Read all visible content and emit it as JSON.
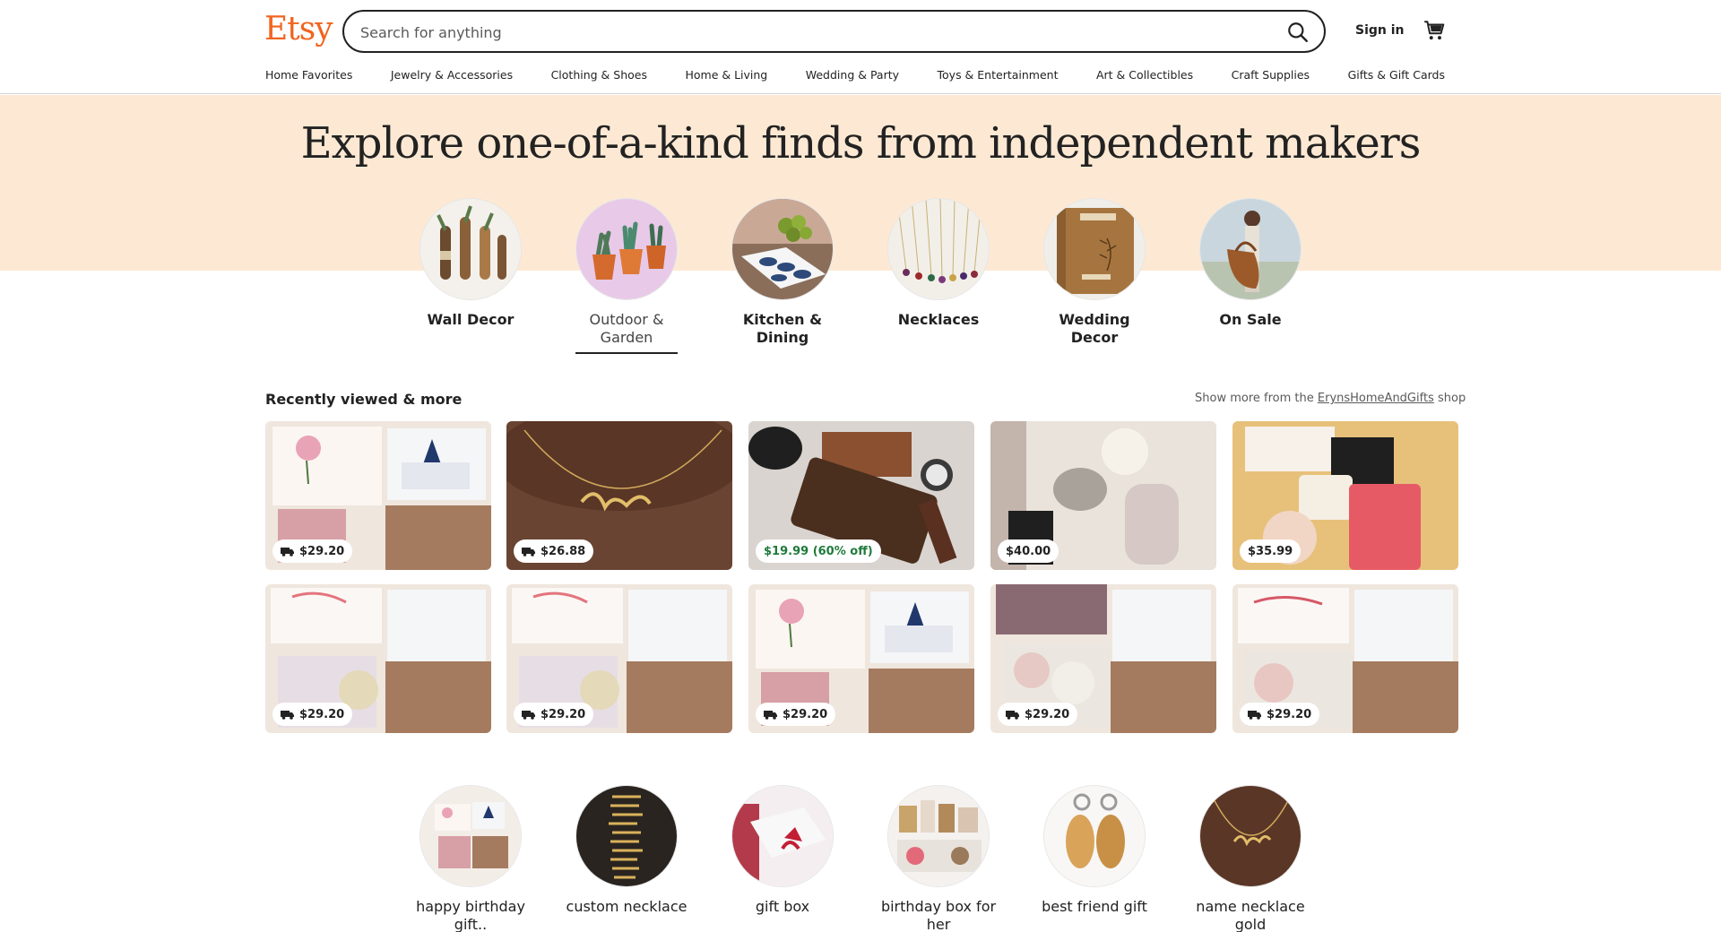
{
  "header": {
    "logo": "Etsy",
    "search_placeholder": "Search for anything",
    "signin": "Sign in",
    "nav": [
      "Home Favorites",
      "Jewelry & Accessories",
      "Clothing & Shoes",
      "Home & Living",
      "Wedding & Party",
      "Toys & Entertainment",
      "Art & Collectibles",
      "Craft Supplies",
      "Gifts & Gift Cards"
    ]
  },
  "hero": {
    "title": "Explore one-of-a-kind finds from independent makers",
    "categories": [
      {
        "label": "Wall Decor",
        "active": false
      },
      {
        "label": "Outdoor & Garden",
        "active": true
      },
      {
        "label": "Kitchen & Dining",
        "active": false
      },
      {
        "label": "Necklaces",
        "active": false
      },
      {
        "label": "Wedding Decor",
        "active": false
      },
      {
        "label": "On Sale",
        "active": false
      }
    ]
  },
  "recently_viewed": {
    "title": "Recently viewed & more",
    "more_prefix": "Show more from the",
    "shop_name": "ErynsHomeAndGifts",
    "more_suffix": "shop",
    "items": [
      {
        "price": "$29.20",
        "free_shipping": true,
        "sale": false
      },
      {
        "price": "$26.88",
        "free_shipping": true,
        "sale": false
      },
      {
        "price": "$19.99 (60% off)",
        "free_shipping": false,
        "sale": true
      },
      {
        "price": "$40.00",
        "free_shipping": false,
        "sale": false
      },
      {
        "price": "$35.99",
        "free_shipping": false,
        "sale": false
      },
      {
        "price": "$29.20",
        "free_shipping": true,
        "sale": false
      },
      {
        "price": "$29.20",
        "free_shipping": true,
        "sale": false
      },
      {
        "price": "$29.20",
        "free_shipping": true,
        "sale": false
      },
      {
        "price": "$29.20",
        "free_shipping": true,
        "sale": false
      },
      {
        "price": "$29.20",
        "free_shipping": true,
        "sale": false
      }
    ]
  },
  "searches": [
    "happy birthday gift..",
    "custom necklace",
    "gift box",
    "birthday box for her",
    "best friend gift",
    "name necklace gold"
  ],
  "colors": {
    "brand": "#f1641e",
    "hero_bg": "#fde9d3",
    "sale_green": "#1f7a3a"
  }
}
